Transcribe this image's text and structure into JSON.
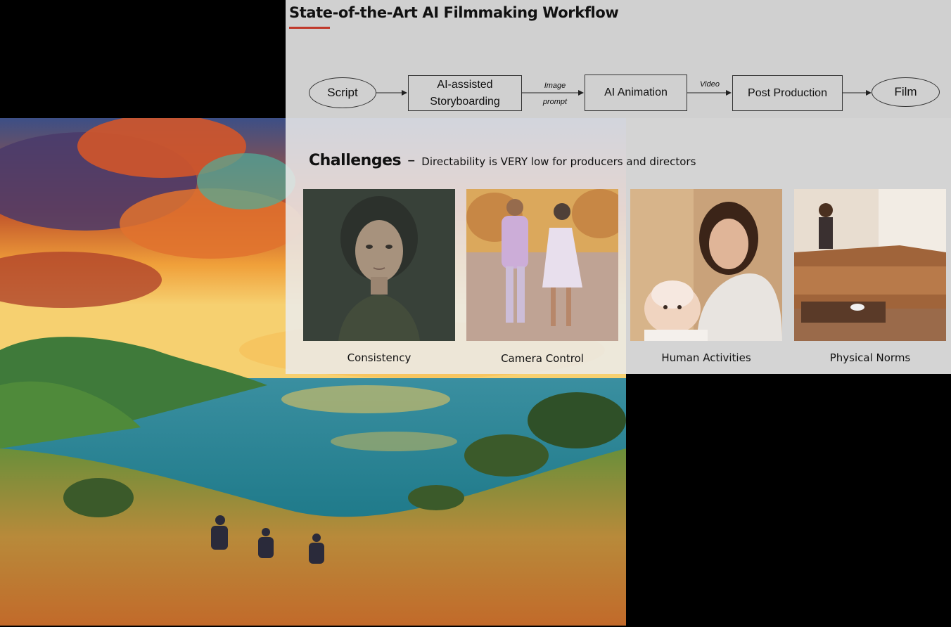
{
  "slide": {
    "title": "State-of-the-Art AI Filmmaking Workflow",
    "accent_color": "#c0392b"
  },
  "workflow": {
    "nodes": [
      {
        "id": "script",
        "label": "Script",
        "shape": "ellipse"
      },
      {
        "id": "storyboarding",
        "label": "AI-assisted Storyboarding",
        "shape": "box"
      },
      {
        "id": "animation",
        "label": "AI Animation",
        "shape": "box"
      },
      {
        "id": "post",
        "label": "Post Production",
        "shape": "box"
      },
      {
        "id": "film",
        "label": "Film",
        "shape": "ellipse"
      }
    ],
    "edges": [
      {
        "from": "script",
        "to": "storyboarding",
        "label": ""
      },
      {
        "from": "storyboarding",
        "to": "animation",
        "label": "Image prompt"
      },
      {
        "from": "animation",
        "to": "post",
        "label": "Video"
      },
      {
        "from": "post",
        "to": "film",
        "label": ""
      }
    ]
  },
  "challenges": {
    "heading": "Challenges",
    "dash": "–",
    "subtitle": "Directability is VERY low for producers and directors",
    "items": [
      {
        "caption": "Consistency",
        "image": "portrait-young-woman"
      },
      {
        "caption": "Camera Control",
        "image": "couple-walking-street"
      },
      {
        "caption": "Human Activities",
        "image": "mother-with-baby"
      },
      {
        "caption": "Physical Norms",
        "image": "living-room-leather-sofa"
      }
    ]
  },
  "background_image": "impressionist-sunset-coast-landscape"
}
